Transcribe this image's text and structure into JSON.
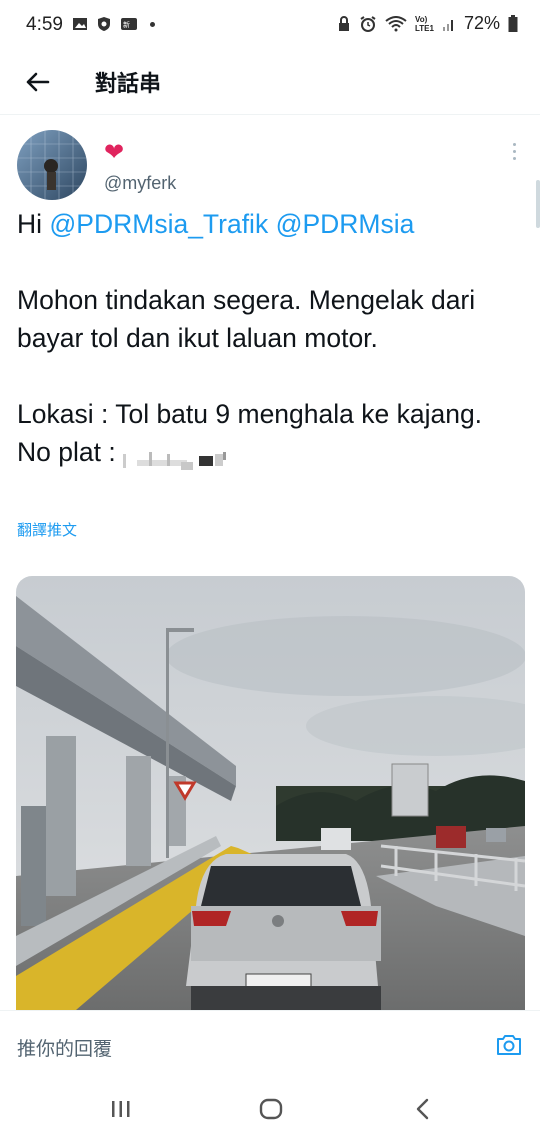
{
  "status_bar": {
    "time": "4:59",
    "network_label": "Vo)\nLTE1",
    "battery": "72%"
  },
  "app_bar": {
    "title": "對話串",
    "back_icon": "arrow-left-icon"
  },
  "tweet": {
    "handle": "@myferk",
    "name_icon": "heart-icon",
    "greeting": "Hi ",
    "mention_1": "@PDRMsia_Trafik",
    "mention_2": "@PDRMsia",
    "para_2": "Mohon tindakan segera. Mengelak dari bayar tol dan ikut laluan motor.",
    "location_line": "Lokasi : Tol batu 9 menghala ke kajang.",
    "plate_label": "No plat : ",
    "translate_label": "翻譯推文"
  },
  "reply_bar": {
    "placeholder": "推你的回覆",
    "camera_icon": "camera-icon"
  },
  "colors": {
    "accent": "#1d9bf0",
    "heart": "#e0245e",
    "text": "#0f1419",
    "secondary": "#536471"
  }
}
